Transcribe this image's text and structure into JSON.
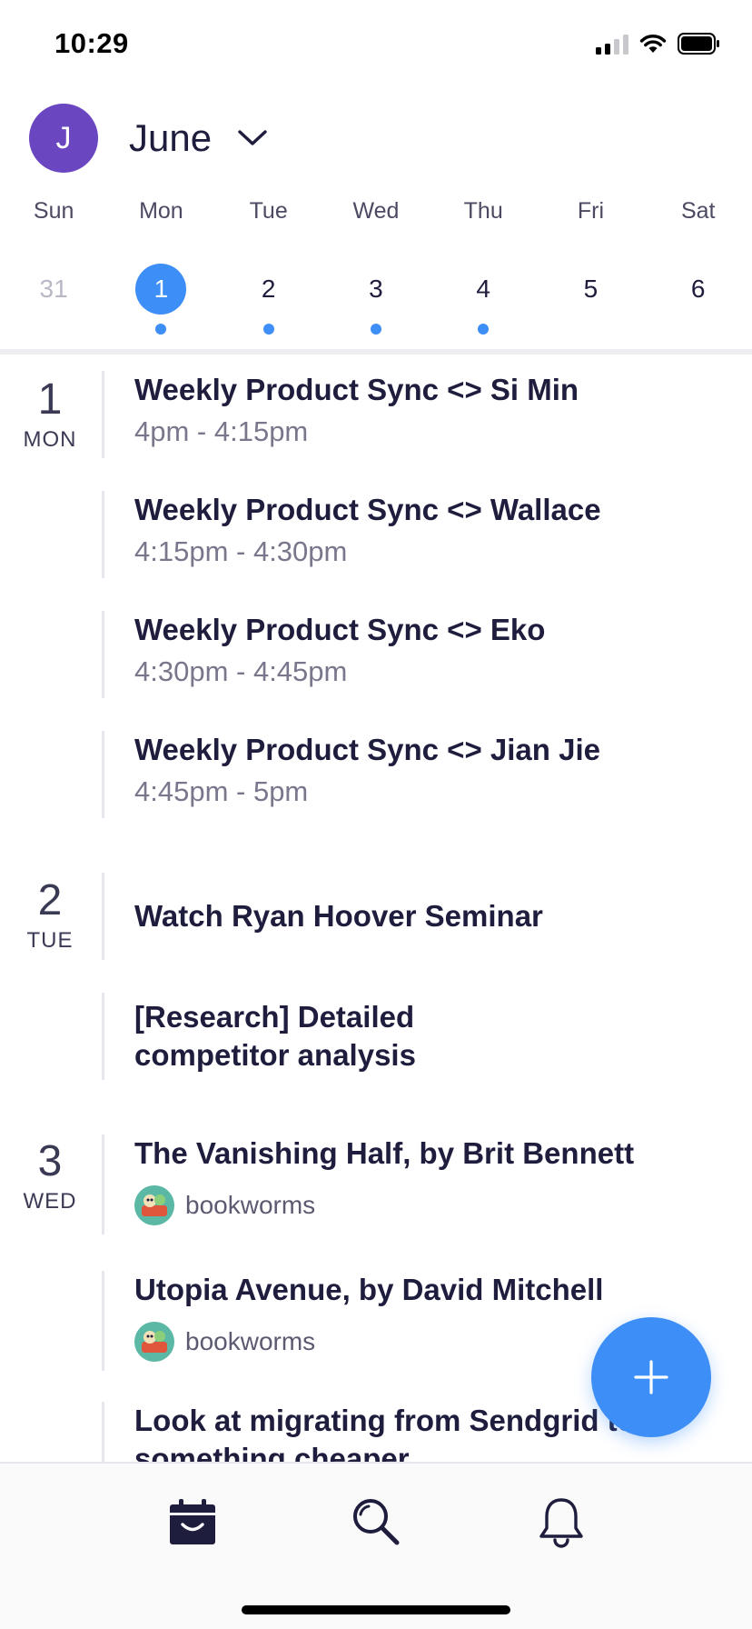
{
  "status_bar": {
    "time": "10:29"
  },
  "header": {
    "avatar_initial": "J",
    "month": "June"
  },
  "week": [
    {
      "dow": "Sun",
      "day": "31",
      "state": "muted",
      "has_events": false
    },
    {
      "dow": "Mon",
      "day": "1",
      "state": "selected",
      "has_events": true
    },
    {
      "dow": "Tue",
      "day": "2",
      "state": "normal",
      "has_events": true
    },
    {
      "dow": "Wed",
      "day": "3",
      "state": "normal",
      "has_events": true
    },
    {
      "dow": "Thu",
      "day": "4",
      "state": "normal",
      "has_events": true
    },
    {
      "dow": "Fri",
      "day": "5",
      "state": "normal",
      "has_events": false
    },
    {
      "dow": "Sat",
      "day": "6",
      "state": "normal",
      "has_events": false
    }
  ],
  "agenda": {
    "days": [
      {
        "num": "1",
        "dow": "MON"
      },
      {
        "num": "2",
        "dow": "TUE"
      },
      {
        "num": "3",
        "dow": "WED"
      }
    ],
    "events": [
      {
        "title": "Weekly Product Sync <> Si Min",
        "time": "4pm - 4:15pm"
      },
      {
        "title": "Weekly Product Sync <> Wallace",
        "time": "4:15pm - 4:30pm"
      },
      {
        "title": "Weekly Product Sync <> Eko",
        "time": "4:30pm - 4:45pm"
      },
      {
        "title": "Weekly Product Sync <> Jian Jie",
        "time": "4:45pm - 5pm"
      },
      {
        "title": "Watch Ryan Hoover Seminar"
      },
      {
        "title": "[Research] Detailed\ncompetitor analysis"
      },
      {
        "title": "The Vanishing Half, by Brit Bennett",
        "group": "bookworms"
      },
      {
        "title": "Utopia Avenue, by David Mitchell",
        "group": "bookworms"
      },
      {
        "title": "Look at migrating from Sendgrid to\nsomething cheaper"
      }
    ]
  },
  "colors": {
    "accent": "#3d8ef7",
    "avatar": "#6b46c1",
    "text": "#1f1d3d"
  },
  "icons": {
    "fab": "plus-icon",
    "tabs": [
      "calendar-icon",
      "search-icon",
      "bell-icon"
    ]
  }
}
